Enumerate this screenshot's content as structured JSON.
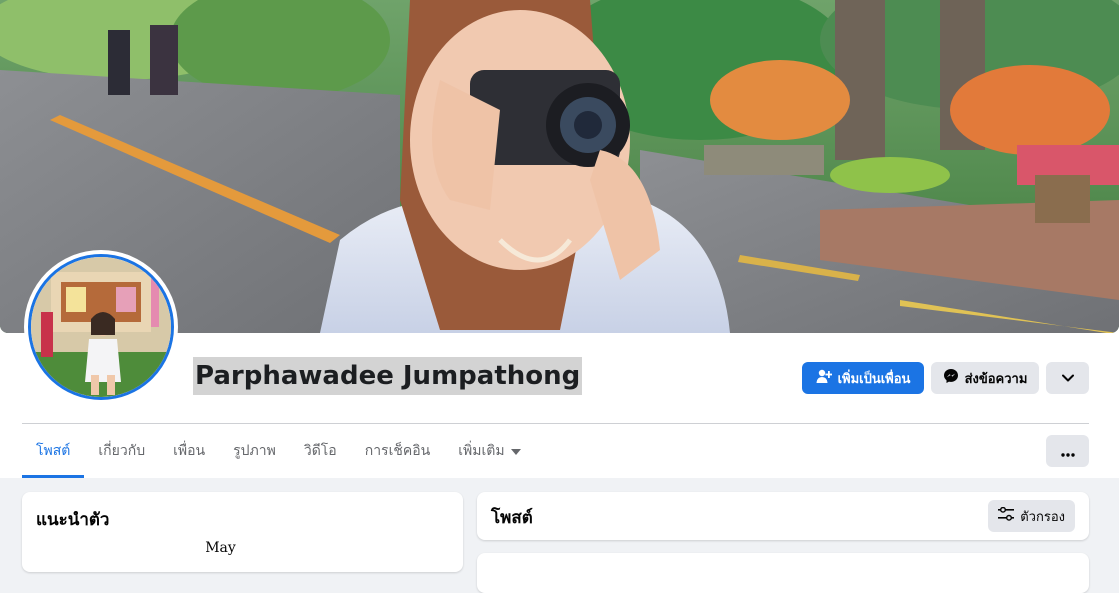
{
  "profile": {
    "name": "Parphawadee Jumpathong"
  },
  "actions": {
    "add_friend_label": "เพิ่มเป็นเพื่อน",
    "message_label": "ส่งข้อความ"
  },
  "tabs": [
    {
      "label": "โพสต์",
      "active": true
    },
    {
      "label": "เกี่ยวกับ"
    },
    {
      "label": "เพื่อน"
    },
    {
      "label": "รูปภาพ"
    },
    {
      "label": "วิดีโอ"
    },
    {
      "label": "การเช็คอิน"
    },
    {
      "label": "เพิ่มเติม"
    }
  ],
  "intro": {
    "title": "แนะนำตัว",
    "bio": "May"
  },
  "posts": {
    "title": "โพสต์",
    "filter_label": "ตัวกรอง"
  },
  "colors": {
    "accent": "#1b74e4",
    "secondary_button": "#e4e6eb",
    "page_background": "#f0f2f5"
  }
}
